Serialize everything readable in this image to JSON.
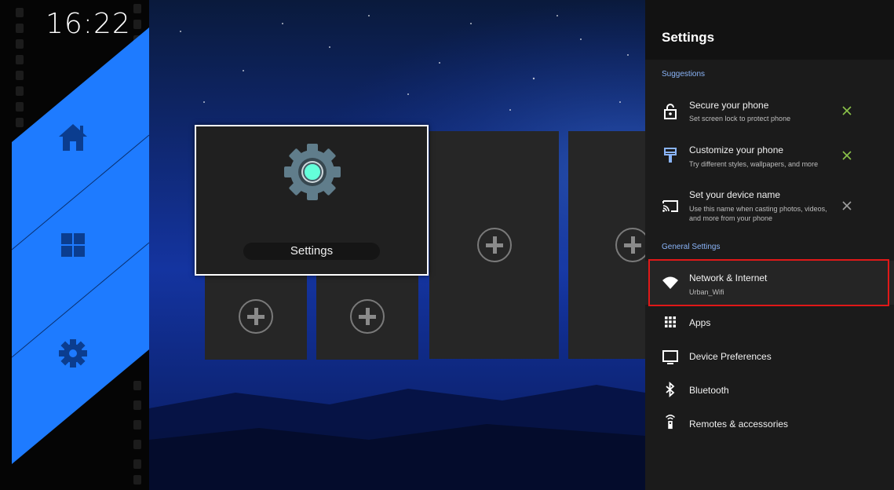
{
  "clock": {
    "time": "16:22"
  },
  "colors": {
    "accent_blue": "#1e7bff",
    "panel_bg": "#1b1b1b",
    "section_blue": "#8ab4f8",
    "highlight_red": "#e01818"
  },
  "launcher": {
    "nav": [
      {
        "icon": "home-icon"
      },
      {
        "icon": "apps-grid-icon"
      },
      {
        "icon": "gear-icon"
      }
    ],
    "focused_app": {
      "label": "Settings",
      "icon": "settings-gear-icon"
    },
    "empty_slot_icon": "add-icon"
  },
  "settings": {
    "title": "Settings",
    "suggestions_header": "Suggestions",
    "suggestions": [
      {
        "title": "Secure your phone",
        "subtitle": "Set screen lock to protect phone",
        "icon": "lock-icon"
      },
      {
        "title": "Customize your phone",
        "subtitle": "Try different styles, wallpapers, and more",
        "icon": "paintbrush-icon"
      },
      {
        "title": "Set your device name",
        "subtitle": "Use this name when casting photos, videos, and more from your phone",
        "icon": "cast-icon"
      }
    ],
    "general_header": "General Settings",
    "items": [
      {
        "title": "Network & Internet",
        "subtitle": "Urban_Wifi",
        "icon": "wifi-icon"
      },
      {
        "title": "Apps",
        "icon": "apps-icon"
      },
      {
        "title": "Device Preferences",
        "icon": "monitor-icon"
      },
      {
        "title": "Bluetooth",
        "icon": "bluetooth-icon"
      },
      {
        "title": "Remotes & accessories",
        "icon": "remote-icon"
      }
    ]
  }
}
